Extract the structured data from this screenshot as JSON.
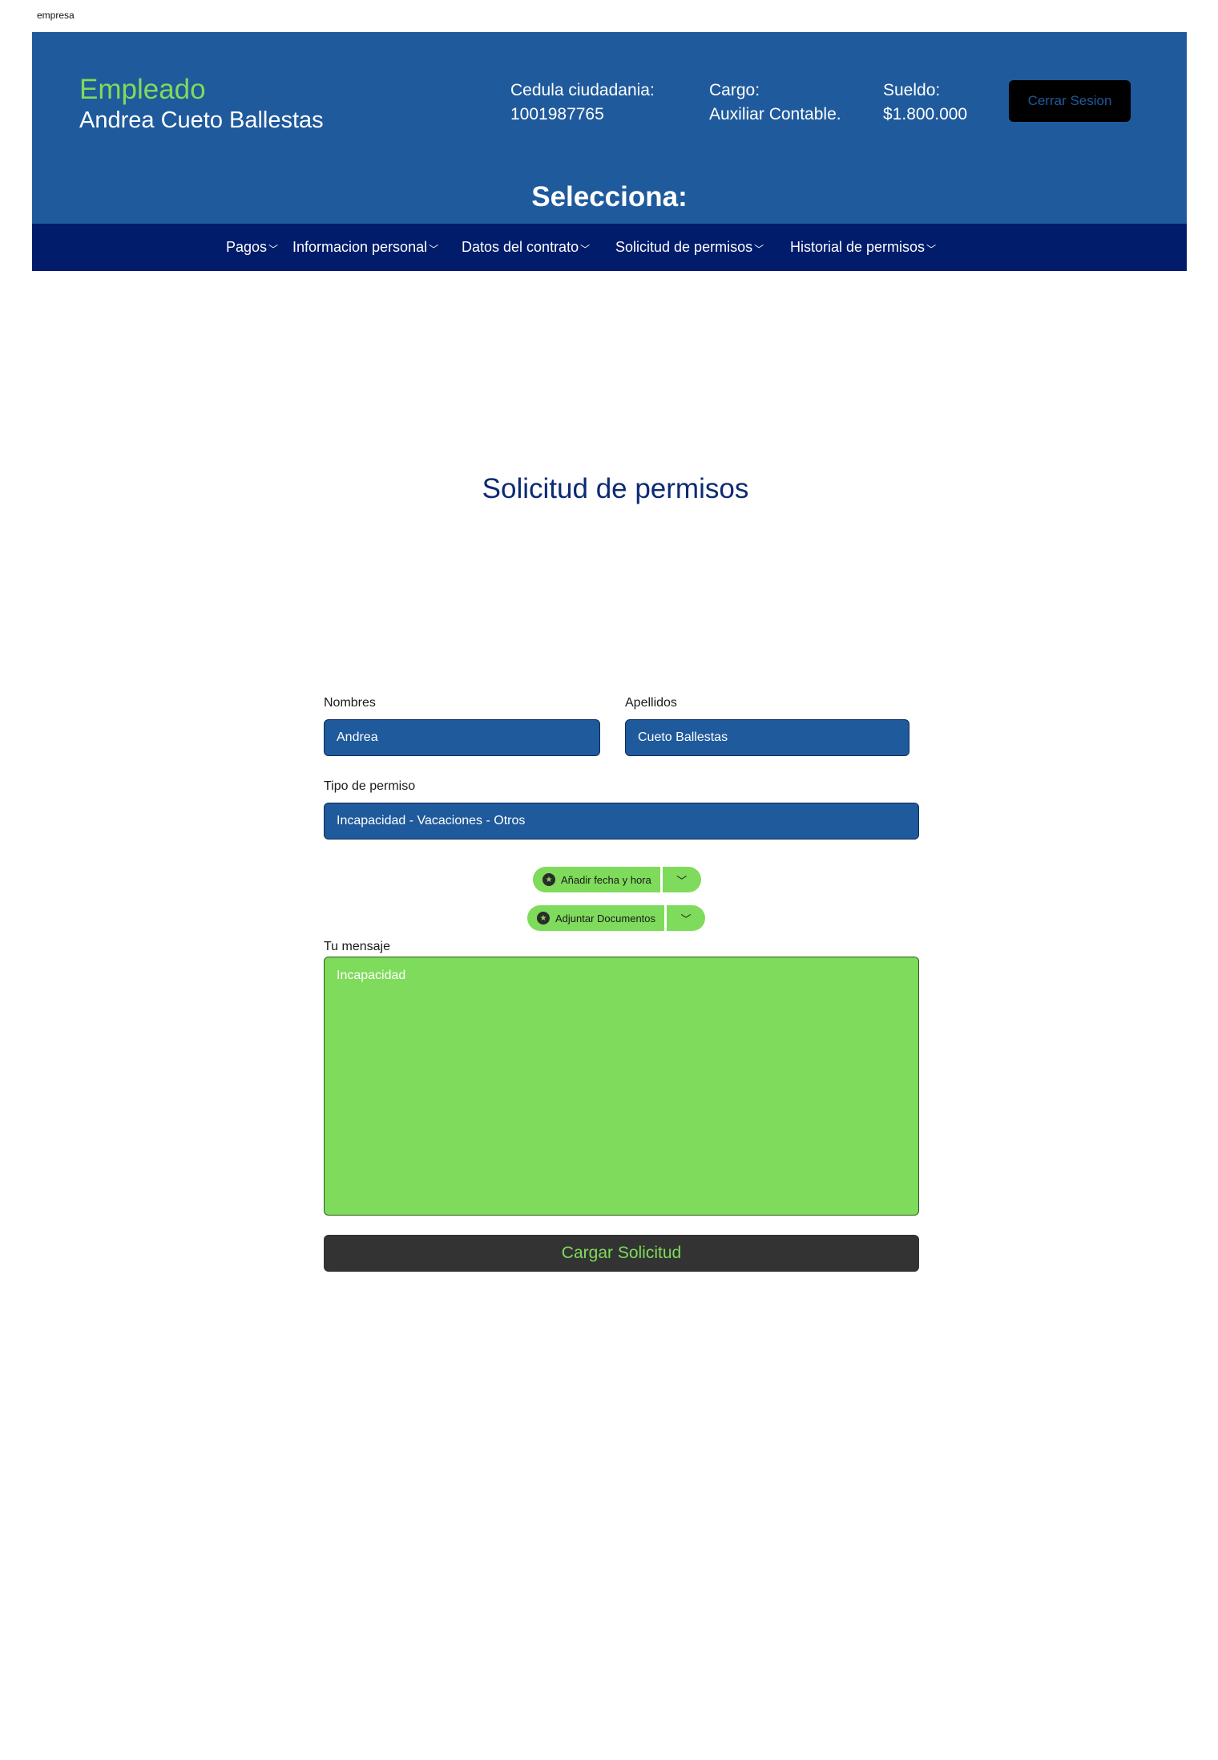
{
  "brand": "empresa",
  "header": {
    "role": "Empleado",
    "name": "Andrea Cueto Ballestas",
    "cedula_label": "Cedula ciudadania:",
    "cedula_value": "1001987765",
    "cargo_label": "Cargo:",
    "cargo_value": "Auxiliar Contable.",
    "sueldo_label": "Sueldo:",
    "sueldo_value": "$1.800.000",
    "logout_label": "Cerrar Sesion",
    "select_heading": "Selecciona:"
  },
  "nav": {
    "items": [
      {
        "label": "Pagos"
      },
      {
        "label": "Informacion personal"
      },
      {
        "label": "Datos del contrato"
      },
      {
        "label": "Solicitud de permisos"
      },
      {
        "label": "Historial de permisos"
      }
    ]
  },
  "form": {
    "title": "Solicitud de permisos",
    "nombres_label": "Nombres",
    "nombres_value": "Andrea",
    "apellidos_label": "Apellidos",
    "apellidos_value": "Cueto Ballestas",
    "tipo_label": "Tipo de permiso",
    "tipo_value": "Incapacidad - Vacaciones - Otros",
    "add_date_label": "Añadir fecha y hora",
    "attach_label": "Adjuntar Documentos",
    "mensaje_label": "Tu mensaje",
    "mensaje_value": "Incapacidad",
    "submit_label": "Cargar Solicitud"
  },
  "colors": {
    "header_bg": "#1f5a9c",
    "nav_bg": "#001c6b",
    "accent_green": "#7fdb5b",
    "title_blue": "#0d2b73",
    "button_dark": "#333333"
  },
  "icons": [
    "chevron-down-icon",
    "star-icon"
  ]
}
